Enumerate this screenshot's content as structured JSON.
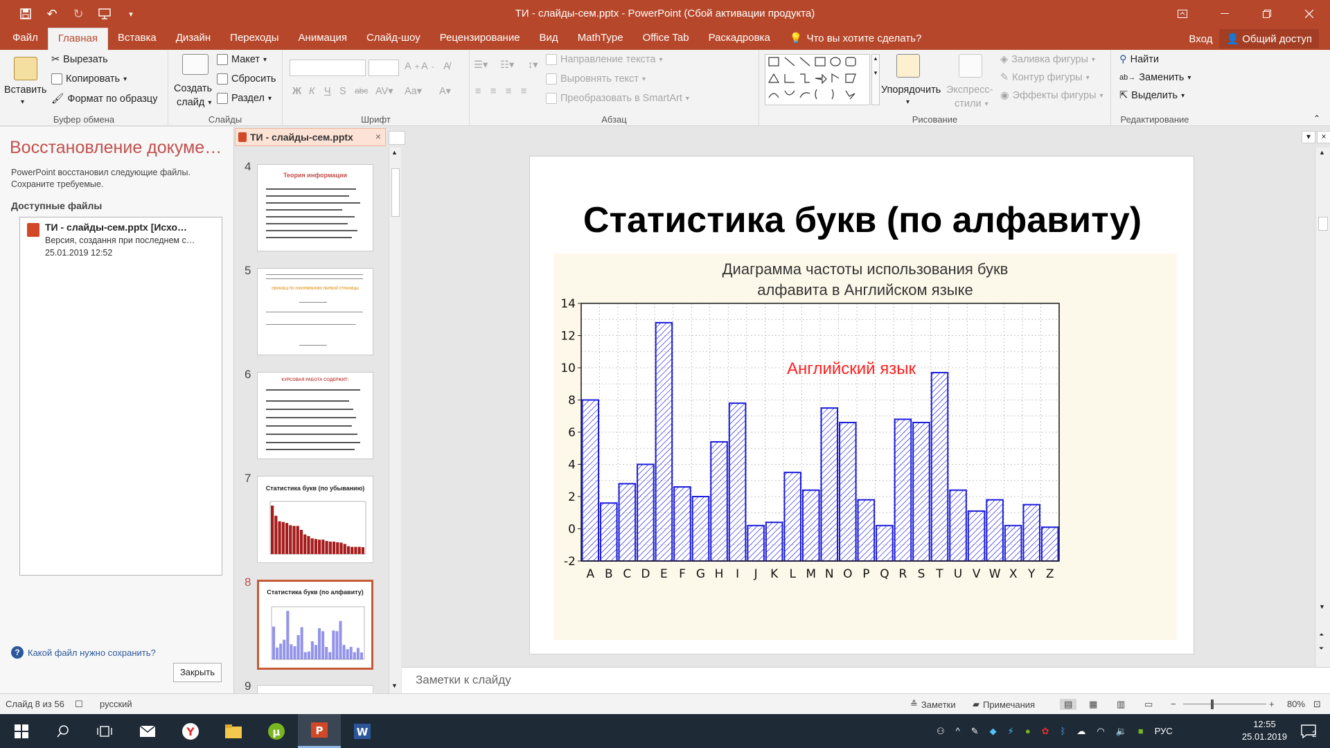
{
  "window": {
    "title": "ТИ - слайды-сем.pptx - PowerPoint (Сбой активации продукта)",
    "qat_icons": [
      "save-icon",
      "undo-icon",
      "redo-icon",
      "present-from-start-icon",
      "customize-qat-icon"
    ]
  },
  "tabs": [
    "Файл",
    "Главная",
    "Вставка",
    "Дизайн",
    "Переходы",
    "Анимация",
    "Слайд-шоу",
    "Рецензирование",
    "Вид",
    "MathType",
    "Office Tab",
    "Раскадровка"
  ],
  "active_tab": "Главная",
  "tell_me": "Что вы хотите сделать?",
  "login": "Вход",
  "share": "Общий доступ",
  "ribbon": {
    "clipboard": {
      "label": "Буфер обмена",
      "paste": "Вставить",
      "cut": "Вырезать",
      "copy": "Копировать",
      "format_painter": "Формат по образцу"
    },
    "slides": {
      "label": "Слайды",
      "new_slide_1": "Создать",
      "new_slide_2": "слайд",
      "layout": "Макет",
      "reset": "Сбросить",
      "section": "Раздел"
    },
    "font": {
      "label": "Шрифт",
      "bold": "Ж",
      "italic": "К",
      "underline": "Ч",
      "strike": "S",
      "shadow": "abc"
    },
    "paragraph": {
      "label": "Абзац",
      "text_direction": "Направление текста",
      "align_text": "Выровнять текст",
      "smartart": "Преобразовать в SmartArt"
    },
    "drawing": {
      "label": "Рисование",
      "arrange": "Упорядочить",
      "quick_styles_1": "Экспресс-",
      "quick_styles_2": "стили",
      "shape_fill": "Заливка фигуры",
      "shape_outline": "Контур фигуры",
      "shape_effects": "Эффекты фигуры"
    },
    "editing": {
      "label": "Редактирование",
      "find": "Найти",
      "replace": "Заменить",
      "select": "Выделить"
    }
  },
  "recovery": {
    "title": "Восстановление докуме…",
    "description": "PowerPoint восстановил следующие файлы. Сохраните требуемые.",
    "available_label": "Доступные файлы",
    "file_name": "ТИ - слайды-сем.pptx  [Исхо…",
    "file_version": "Версия, создання при последнем с…",
    "file_date": "25.01.2019 12:52",
    "help": "Какой файл нужно сохранить?",
    "close": "Закрыть"
  },
  "doc_tab": "ТИ - слайды-сем.pptx",
  "thumbnails": [
    {
      "num": "4",
      "title": "Теория информации"
    },
    {
      "num": "5",
      "title": "ОБРАЗЕЦ ПО ОФОРМЛЕНИЮ ПЕРВОЙ СТРАНИЦЫ"
    },
    {
      "num": "6",
      "title": "КУРСОВАЯ РАБОТА СОДЕРЖИТ:"
    },
    {
      "num": "7",
      "title": "Статистика букв (по убыванию)"
    },
    {
      "num": "8",
      "title": "Статистика букв (по алфавиту)"
    },
    {
      "num": "9",
      "title": ""
    }
  ],
  "active_thumbnail": "8",
  "slide": {
    "title": "Статистика букв (по алфавиту)"
  },
  "chart_data": {
    "type": "bar",
    "title": "Диаграмма частоты использования букв алфавита в Английском языке",
    "title_line1": "Диаграмма частоты использования букв",
    "title_line2": "алфавита в Английском языке",
    "annotation": "Английский язык",
    "categories": [
      "A",
      "B",
      "C",
      "D",
      "E",
      "F",
      "G",
      "H",
      "I",
      "J",
      "K",
      "L",
      "M",
      "N",
      "O",
      "P",
      "Q",
      "R",
      "S",
      "T",
      "U",
      "V",
      "W",
      "X",
      "Y",
      "Z"
    ],
    "values": [
      8.0,
      1.6,
      2.8,
      4.0,
      12.8,
      2.6,
      2.0,
      5.4,
      7.8,
      0.2,
      0.4,
      3.5,
      2.4,
      7.5,
      6.6,
      1.8,
      0.2,
      6.8,
      6.6,
      9.7,
      2.4,
      1.1,
      1.8,
      0.2,
      1.5,
      0.1
    ],
    "baseline": -2,
    "ylim": [
      -2,
      14
    ],
    "yticks": [
      "14",
      "12",
      "10",
      "8",
      "6",
      "4",
      "2",
      "0",
      "-2"
    ],
    "grid": true,
    "bar_color": "#1a1adc",
    "annotation_color": "#ff2020"
  },
  "notes_placeholder": "Заметки к слайду",
  "status": {
    "slide_info": "Слайд 8 из 56",
    "language": "русский",
    "notes": "Заметки",
    "comments": "Примечания",
    "zoom": "80%"
  },
  "taskbar": {
    "lang": "РУС",
    "time": "12:55",
    "date": "25.01.2019",
    "notif_count": "2"
  }
}
